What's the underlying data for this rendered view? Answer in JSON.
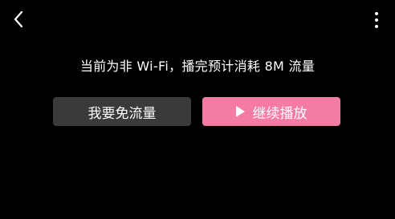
{
  "header": {
    "back_icon": "chevron-left-icon",
    "more_icon": "vertical-ellipsis-icon"
  },
  "notice": {
    "text": "当前为非 Wi-Fi，播完预计消耗 8M 流量"
  },
  "buttons": {
    "free_data_label": "我要免流量",
    "continue_label": "继续播放",
    "continue_icon": "play-icon"
  },
  "colors": {
    "background": "#000000",
    "free_button_bg": "#3a3a3a",
    "continue_button_bg": "#f47ba2",
    "text": "#ffffff"
  }
}
